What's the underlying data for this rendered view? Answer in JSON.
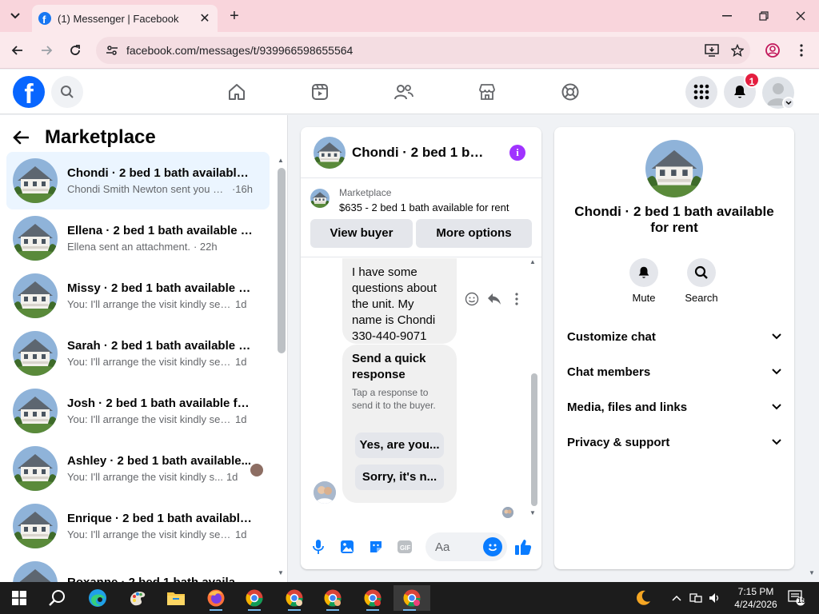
{
  "browser": {
    "tab_title": "(1) Messenger | Facebook",
    "new_tab_label": "+",
    "url": "facebook.com/messages/t/939966598655564"
  },
  "fb": {
    "notification_count": "1"
  },
  "sidebar": {
    "title": "Marketplace",
    "conversations": [
      {
        "name": "Chondi · 2 bed 1 bath available f...",
        "preview": "Chondi Smith Newton sent you a ...",
        "time": "·16h",
        "active": true
      },
      {
        "name": "Ellena · 2 bed 1 bath available fo...",
        "preview": "Ellena sent an attachment.",
        "time": "· 22h",
        "active": false
      },
      {
        "name": "Missy · 2 bed 1 bath available fo...",
        "preview": "You: I'll arrange the visit kindly sen...",
        "time": "1d",
        "active": false
      },
      {
        "name": "Sarah · 2 bed 1 bath available fo...",
        "preview": "You: I'll arrange the visit kindly sen...",
        "time": "1d",
        "active": false
      },
      {
        "name": "Josh · 2 bed 1 bath available for ...",
        "preview": "You: I'll arrange the visit kindly sen...",
        "time": "1d",
        "active": false
      },
      {
        "name": "Ashley · 2 bed 1 bath available...",
        "preview": "You: I'll arrange the visit kindly s...",
        "time": "1d",
        "active": false
      },
      {
        "name": "Enrique · 2 bed 1 bath available f...",
        "preview": "You: I'll arrange the visit kindly sen...",
        "time": "1d",
        "active": false
      },
      {
        "name": "Roxanne · 2 bed 1 bath available...",
        "preview": "",
        "time": "",
        "active": false
      }
    ]
  },
  "chat": {
    "title": "Chondi · 2 bed 1 bat...",
    "info_icon": "i",
    "marketplace_label": "Marketplace",
    "listing": "$635 - 2 bed 1 bath available for rent",
    "view_buyer": "View buyer",
    "more_options": "More options",
    "message_text": "I have some questions about the unit. My name is Chondi 330-440-9071",
    "quick_title": "Send a quick response",
    "quick_desc": "Tap a response to send it to the buyer.",
    "quick_replies": [
      "Yes, are you...",
      "Sorry, it's n..."
    ],
    "composer_placeholder": "Aa"
  },
  "info_panel": {
    "title": "Chondi · 2 bed 1 bath available for rent",
    "mute_label": "Mute",
    "search_label": "Search",
    "sections": [
      "Customize chat",
      "Chat members",
      "Media, files and links",
      "Privacy & support"
    ]
  },
  "taskbar": {
    "time": "7:15 PM",
    "date": "4/24/2026",
    "notifications": "15"
  },
  "colors": {
    "accent": "#0866ff",
    "active_row": "#ebf5ff",
    "info_purple": "#a033ff",
    "chrome_tab": "#f9d5dc"
  }
}
